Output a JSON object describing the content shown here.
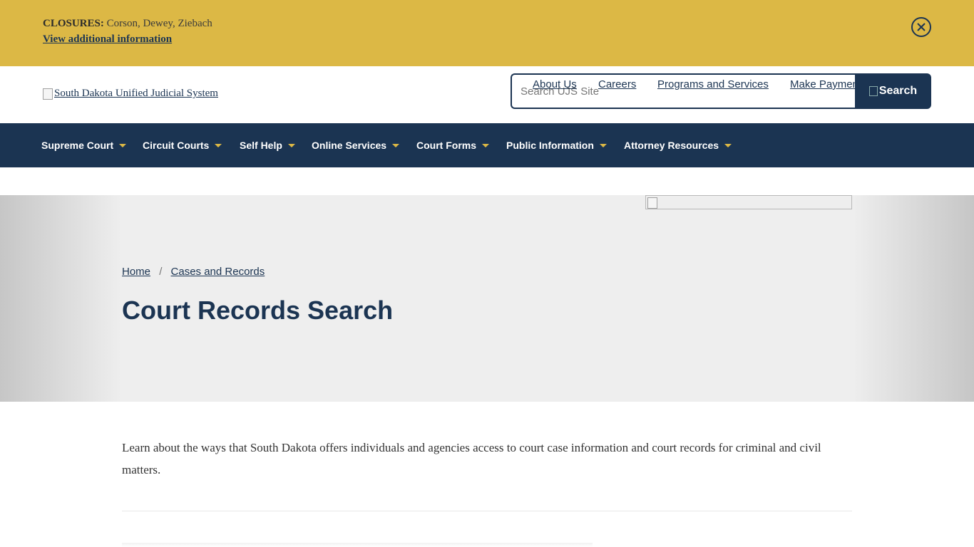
{
  "alert": {
    "label": "CLOSURES:",
    "text": "Corson, Dewey, Ziebach",
    "link": "View additional information",
    "close_icon": "close-circle-icon"
  },
  "header": {
    "logo_alt": "South Dakota Unified Judicial System",
    "search": {
      "placeholder": "Search UJS Site",
      "button_label": "Search"
    },
    "utility_links": [
      "About Us",
      "Careers",
      "Programs and Services",
      "Make Payment"
    ]
  },
  "nav": {
    "items": [
      {
        "label": "Supreme Court"
      },
      {
        "label": "Circuit Courts"
      },
      {
        "label": "Self Help"
      },
      {
        "label": "Online Services"
      },
      {
        "label": "Court Forms"
      },
      {
        "label": "Public Information"
      },
      {
        "label": "Attorney Resources"
      }
    ]
  },
  "breadcrumb": {
    "items": [
      "Home",
      "Cases and Records"
    ],
    "separator": "/"
  },
  "page": {
    "title": "Court Records Search",
    "intro": "Learn about the ways that South Dakota offers individuals and agencies access to court case information and court records for criminal and civil matters."
  },
  "colors": {
    "banner": "#dcb845",
    "navy": "#1b3452",
    "caret": "#dcb845",
    "hero_bg": "#eeeeee"
  }
}
